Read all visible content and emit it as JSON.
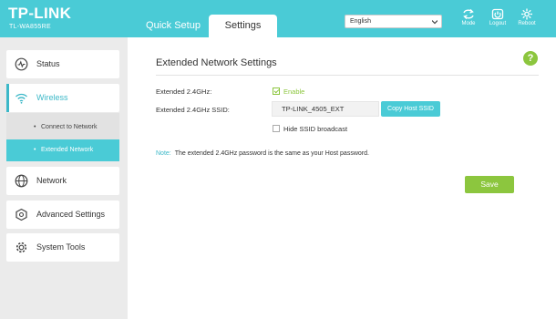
{
  "header": {
    "brand": "TP-LINK",
    "model": "TL-WA855RE",
    "tabs": [
      {
        "label": "Quick Setup",
        "active": false
      },
      {
        "label": "Settings",
        "active": true
      }
    ],
    "language": {
      "selected": "English"
    },
    "buttons": [
      {
        "label": "Mode",
        "icon": "mode-icon"
      },
      {
        "label": "Logout",
        "icon": "logout-icon"
      },
      {
        "label": "Reboot",
        "icon": "reboot-icon"
      }
    ]
  },
  "sidebar": {
    "items": [
      {
        "label": "Status",
        "icon": "status-icon"
      },
      {
        "label": "Wireless",
        "icon": "wireless-icon",
        "active": true
      },
      {
        "label": "Network",
        "icon": "network-icon"
      },
      {
        "label": "Advanced Settings",
        "icon": "advanced-settings-icon"
      },
      {
        "label": "System Tools",
        "icon": "system-tools-icon"
      }
    ],
    "subitems": [
      {
        "label": "Connect to Network",
        "active": false
      },
      {
        "label": "Extended Network",
        "active": true
      }
    ]
  },
  "main": {
    "title": "Extended Network Settings",
    "help": "?",
    "ext24_label": "Extended 2.4GHz:",
    "enable_label": "Enable",
    "enable_checked": true,
    "ssid_label": "Extended 2.4GHz SSID:",
    "ssid_value": "TP-LINK_4505_EXT",
    "copy_button": "Copy Host SSID",
    "hide_ssid_label": "Hide SSID broadcast",
    "hide_ssid_checked": false,
    "note_label": "Note:",
    "note_text": "The extended 2.4GHz password is the same as your Host password.",
    "save_button": "Save"
  },
  "colors": {
    "accent": "#4acbd6",
    "green": "#8cc63e",
    "sidebar_bg": "#ebebeb"
  }
}
